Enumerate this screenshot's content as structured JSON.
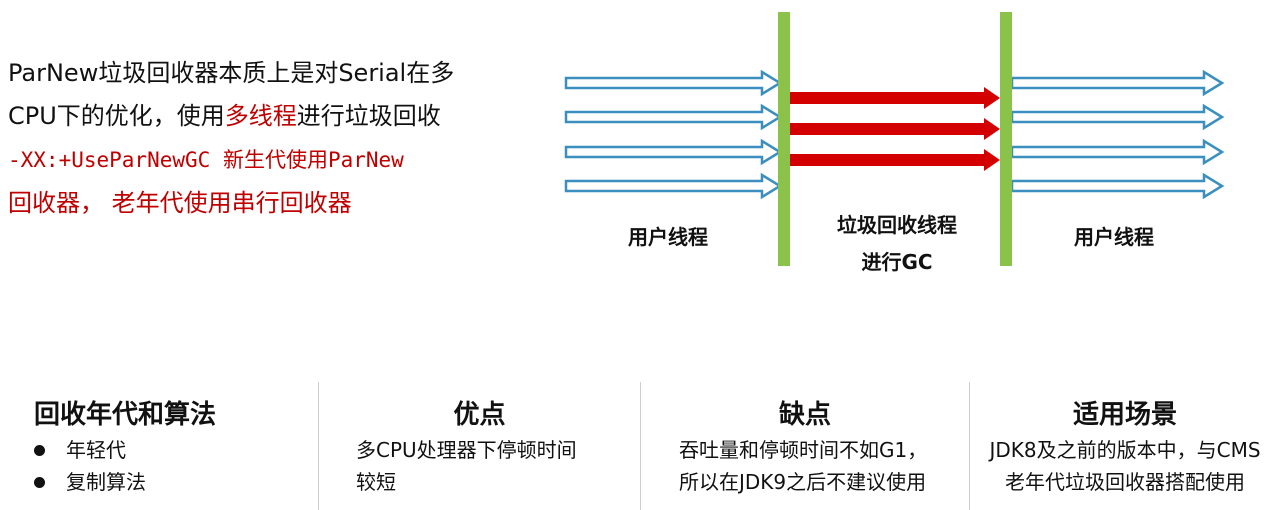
{
  "intro": {
    "line1": "ParNew垃圾回收器本质上是对Serial在多",
    "line2_prefix": "CPU下的优化，使用",
    "line2_highlight": "多线程",
    "line2_suffix": "进行垃圾回收",
    "line3_code": "-XX:+UseParNewGC",
    "line3_rest": " 新生代使用ParNew",
    "line4": "回收器，  老年代使用串行回收器"
  },
  "diagram": {
    "left_label": "用户线程",
    "middle_label_line1": "垃圾回收线程",
    "middle_label_line2": "进行GC",
    "right_label": "用户线程",
    "colors": {
      "user_arrow": "#3a8fbf",
      "gc_arrow": "#d40000",
      "barrier": "#8bc34a"
    }
  },
  "columns": [
    {
      "title": "回收年代和算法",
      "items": [
        "年轻代",
        "复制算法"
      ]
    },
    {
      "title": "优点",
      "text_line1": "多CPU处理器下停顿时间",
      "text_line2": "较短"
    },
    {
      "title": "缺点",
      "text_line1": "吞吐量和停顿时间不如G1，",
      "text_line2": "所以在JDK9之后不建议使用"
    },
    {
      "title": "适用场景",
      "text_line1": "JDK8及之前的版本中，与CMS",
      "text_line2": "老年代垃圾回收器搭配使用"
    }
  ]
}
